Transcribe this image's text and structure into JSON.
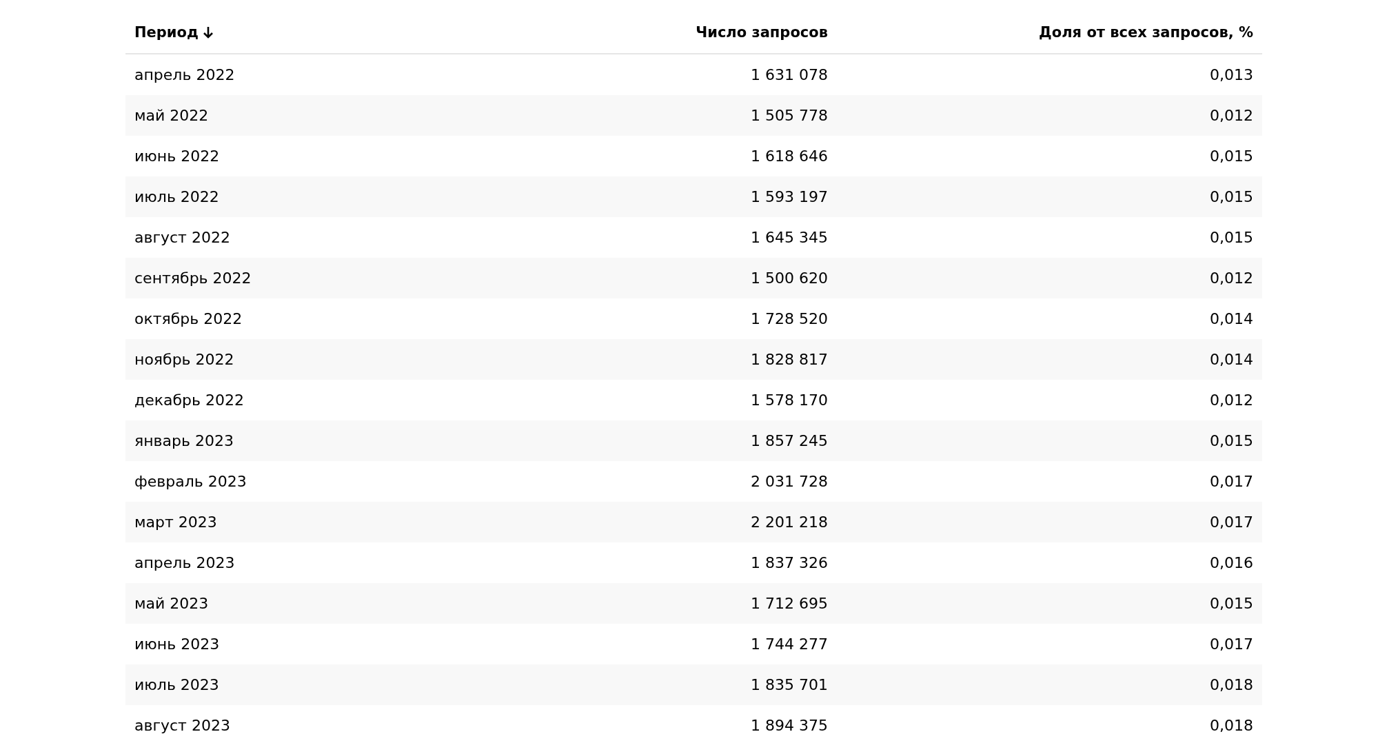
{
  "table": {
    "columns": [
      {
        "label": "Период",
        "sorted": true,
        "kind": "text"
      },
      {
        "label": "Число запросов",
        "sorted": false,
        "kind": "number"
      },
      {
        "label": "Доля от всех запросов, %",
        "sorted": false,
        "kind": "number"
      }
    ],
    "rows": [
      [
        "апрель 2022",
        "1 631 078",
        "0,013"
      ],
      [
        "май 2022",
        "1 505 778",
        "0,012"
      ],
      [
        "июнь 2022",
        "1 618 646",
        "0,015"
      ],
      [
        "июль 2022",
        "1 593 197",
        "0,015"
      ],
      [
        "август 2022",
        "1 645 345",
        "0,015"
      ],
      [
        "сентябрь 2022",
        "1 500 620",
        "0,012"
      ],
      [
        "октябрь 2022",
        "1 728 520",
        "0,014"
      ],
      [
        "ноябрь 2022",
        "1 828 817",
        "0,014"
      ],
      [
        "декабрь 2022",
        "1 578 170",
        "0,012"
      ],
      [
        "январь 2023",
        "1 857 245",
        "0,015"
      ],
      [
        "февраль 2023",
        "2 031 728",
        "0,017"
      ],
      [
        "март 2023",
        "2 201 218",
        "0,017"
      ],
      [
        "апрель 2023",
        "1 837 326",
        "0,016"
      ],
      [
        "май 2023",
        "1 712 695",
        "0,015"
      ],
      [
        "июнь 2023",
        "1 744 277",
        "0,017"
      ],
      [
        "июль 2023",
        "1 835 701",
        "0,018"
      ],
      [
        "август 2023",
        "1 894 375",
        "0,018"
      ]
    ]
  }
}
